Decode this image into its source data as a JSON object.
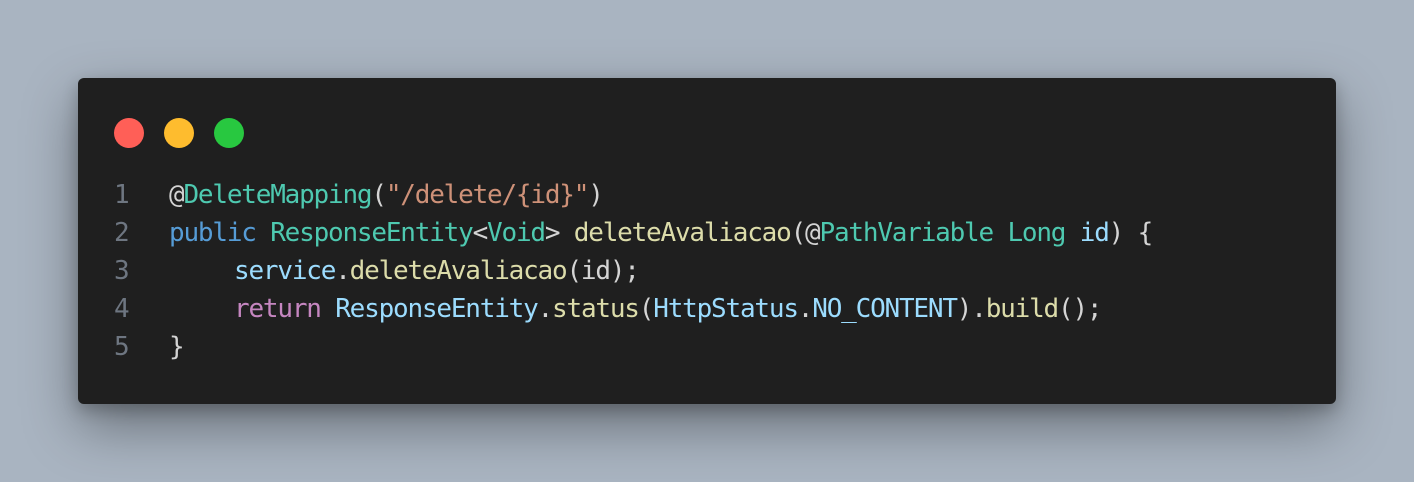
{
  "colors": {
    "background": "#a9b4c1",
    "window": "#1f1f1f",
    "dot_red": "#ff5f57",
    "dot_yellow": "#febc2e",
    "dot_green": "#28c840",
    "plain": "#d4d4d4",
    "annotation_at": "#d4d4d4",
    "type": "#4ec9b0",
    "keyword": "#569cd6",
    "control_keyword": "#c586c0",
    "string": "#ce9178",
    "function": "#dcdcaa",
    "variable": "#9cdcfe",
    "line_number": "#6e7681"
  },
  "window": {
    "controls": {
      "close": "red",
      "minimize": "yellow",
      "maximize": "green"
    }
  },
  "code": {
    "language": "java",
    "lines": [
      {
        "number": "1",
        "tokens": [
          {
            "text": "@",
            "kind": "plain"
          },
          {
            "text": "DeleteMapping",
            "kind": "type"
          },
          {
            "text": "(",
            "kind": "plain"
          },
          {
            "text": "\"/delete/{id}\"",
            "kind": "string"
          },
          {
            "text": ")",
            "kind": "plain"
          }
        ]
      },
      {
        "number": "2",
        "tokens": [
          {
            "text": "public",
            "kind": "keyword"
          },
          {
            "text": " ",
            "kind": "plain"
          },
          {
            "text": "ResponseEntity",
            "kind": "type"
          },
          {
            "text": "<",
            "kind": "plain"
          },
          {
            "text": "Void",
            "kind": "type"
          },
          {
            "text": "> ",
            "kind": "plain"
          },
          {
            "text": "deleteAvaliacao",
            "kind": "function"
          },
          {
            "text": "(@",
            "kind": "plain"
          },
          {
            "text": "PathVariable",
            "kind": "type"
          },
          {
            "text": " ",
            "kind": "plain"
          },
          {
            "text": "Long",
            "kind": "type"
          },
          {
            "text": " ",
            "kind": "plain"
          },
          {
            "text": "id",
            "kind": "variable"
          },
          {
            "text": ") {",
            "kind": "plain"
          }
        ]
      },
      {
        "number": "3",
        "indent": true,
        "tokens": [
          {
            "text": "service",
            "kind": "variable"
          },
          {
            "text": ".",
            "kind": "plain"
          },
          {
            "text": "deleteAvaliacao",
            "kind": "function"
          },
          {
            "text": "(id);",
            "kind": "plain"
          }
        ]
      },
      {
        "number": "4",
        "indent": true,
        "tokens": [
          {
            "text": "return",
            "kind": "control_keyword"
          },
          {
            "text": " ",
            "kind": "plain"
          },
          {
            "text": "ResponseEntity",
            "kind": "variable"
          },
          {
            "text": ".",
            "kind": "plain"
          },
          {
            "text": "status",
            "kind": "function"
          },
          {
            "text": "(",
            "kind": "plain"
          },
          {
            "text": "HttpStatus",
            "kind": "variable"
          },
          {
            "text": ".",
            "kind": "plain"
          },
          {
            "text": "NO_CONTENT",
            "kind": "variable"
          },
          {
            "text": ").",
            "kind": "plain"
          },
          {
            "text": "build",
            "kind": "function"
          },
          {
            "text": "();",
            "kind": "plain"
          }
        ]
      },
      {
        "number": "5",
        "tokens": [
          {
            "text": "}",
            "kind": "plain"
          }
        ]
      }
    ]
  }
}
